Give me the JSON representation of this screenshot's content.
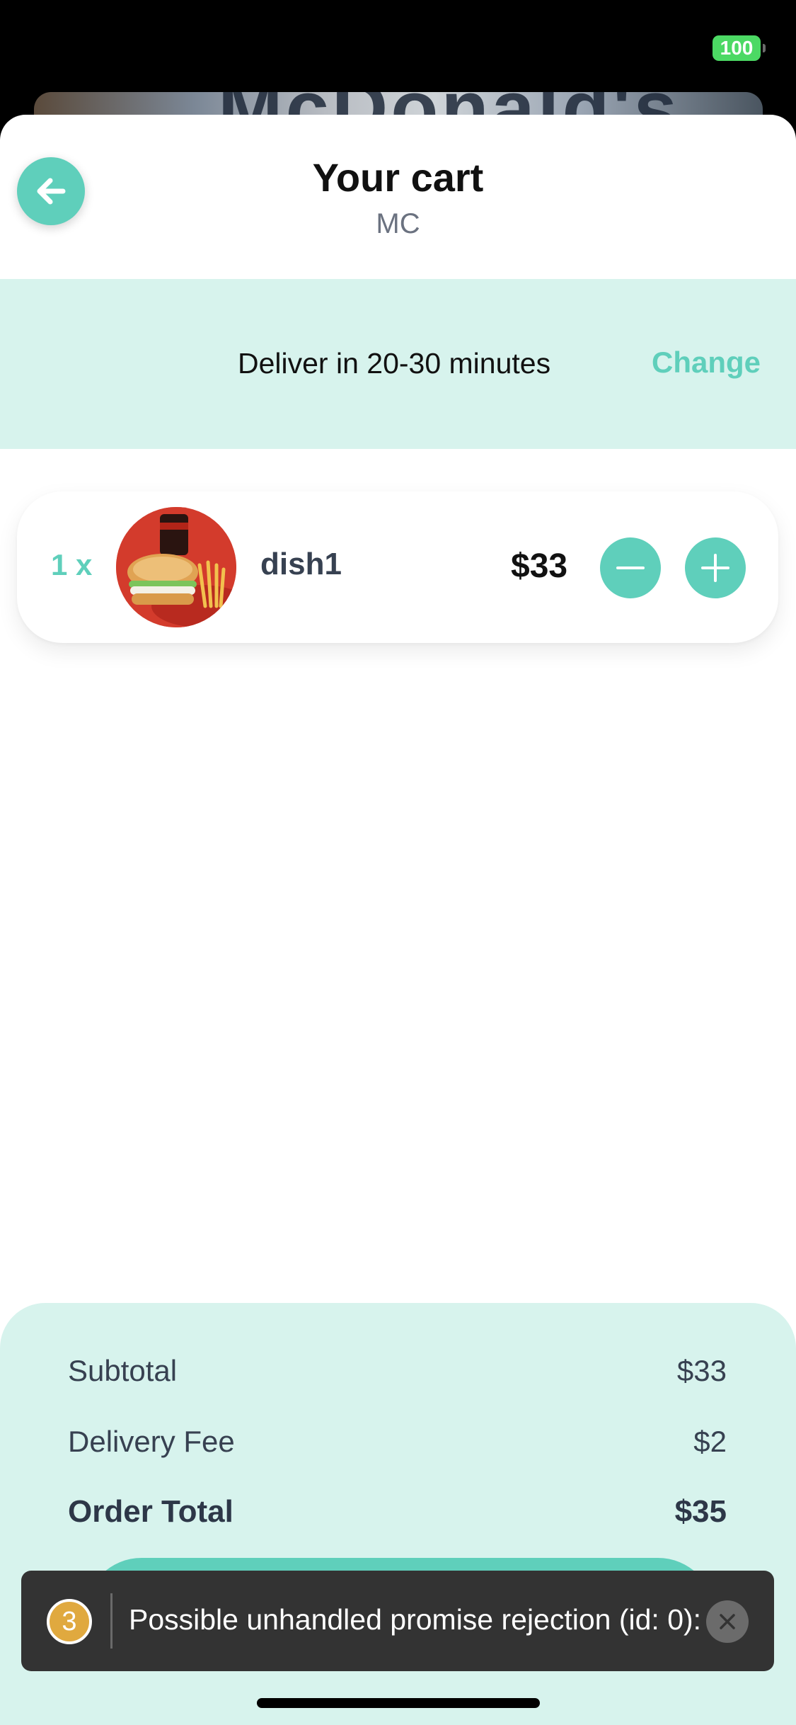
{
  "status_bar": {
    "battery": "100"
  },
  "header": {
    "title": "Your cart",
    "subtitle": "MC"
  },
  "delivery": {
    "text": "Deliver in 20-30 minutes",
    "change_label": "Change"
  },
  "cart_items": [
    {
      "quantity": "1 x",
      "name": "dish1",
      "price": "$33"
    }
  ],
  "summary": {
    "subtotal_label": "Subtotal",
    "subtotal_value": "$33",
    "delivery_fee_label": "Delivery Fee",
    "delivery_fee_value": "$2",
    "order_total_label": "Order Total",
    "order_total_value": "$35"
  },
  "toast": {
    "count": "3",
    "message": "Possible unhandled promise rejection (id: 0):"
  },
  "colors": {
    "accent": "#5fcfbb",
    "tint": "#d7f3ed",
    "toast_bg": "#333333",
    "badge": "#e0a93f"
  },
  "icons": {
    "back": "arrow-left-icon",
    "minus": "minus-icon",
    "plus": "plus-icon",
    "close": "close-icon",
    "battery": "battery-icon"
  }
}
